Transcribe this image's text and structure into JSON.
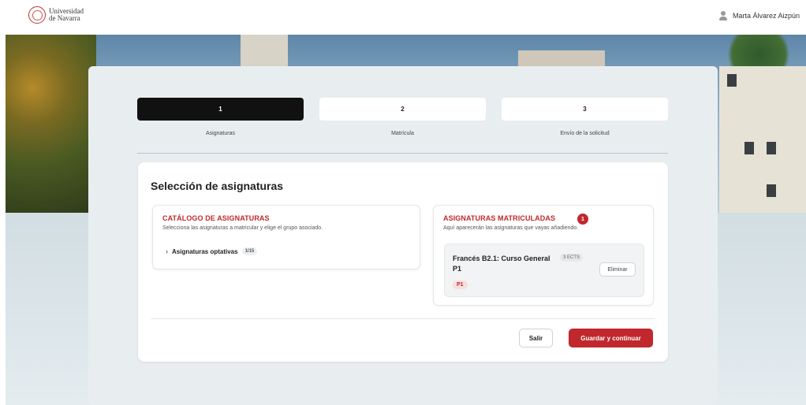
{
  "header": {
    "logo_line1": "Universidad",
    "logo_line2": "de Navarra",
    "user_name": "Marta Álvarez Aizpún"
  },
  "steps": [
    {
      "number": "1",
      "label": "Asignaturas",
      "active": true
    },
    {
      "number": "2",
      "label": "Matrícula",
      "active": false
    },
    {
      "number": "3",
      "label": "Envío de la solicitud",
      "active": false
    }
  ],
  "main": {
    "title": "Selección de asignaturas",
    "catalog": {
      "title": "CATÁLOGO DE ASIGNATURAS",
      "subtitle": "Selecciona las asignaturas a matricular y elige el grupo asociado.",
      "groups": [
        {
          "name": "Asignaturas optativas",
          "count": "1/15"
        }
      ]
    },
    "enrolled": {
      "title": "ASIGNATURAS MATRICULADAS",
      "count": "1",
      "subtitle": "Aquí aparecerán las asignaturas que vayas añadiendo.",
      "subjects": [
        {
          "name": "Francés B2.1: Curso General  P1",
          "ects": "3 ECTS",
          "group": "P1",
          "remove_label": "Eliminar"
        }
      ]
    }
  },
  "actions": {
    "exit_label": "Salir",
    "save_label": "Guardar y continuar"
  },
  "colors": {
    "accent": "#c0282d",
    "active_step": "#111111"
  }
}
